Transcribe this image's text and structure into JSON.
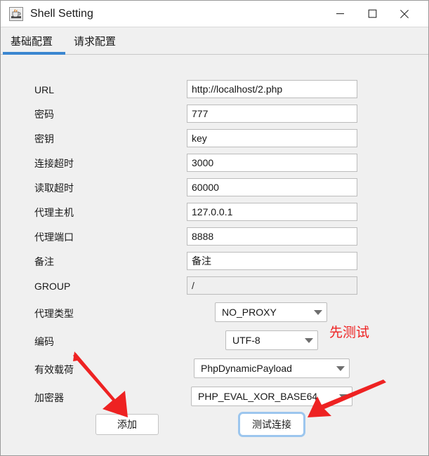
{
  "window": {
    "title": "Shell Setting",
    "icon": "java-coffee-cup-icon",
    "controls": {
      "minimize": "minimize-icon",
      "maximize": "maximize-icon",
      "close": "close-icon"
    }
  },
  "tabs": [
    {
      "label": "基础配置",
      "active": true
    },
    {
      "label": "请求配置",
      "active": false
    }
  ],
  "accent_color": "#3b87d0",
  "annotation_color": "#ee2222",
  "form": {
    "fields": [
      {
        "label": "URL",
        "value": "http://localhost/2.php",
        "type": "text"
      },
      {
        "label": "密码",
        "value": "777",
        "type": "text"
      },
      {
        "label": "密钥",
        "value": "key",
        "type": "text"
      },
      {
        "label": "连接超时",
        "value": "3000",
        "type": "text"
      },
      {
        "label": "读取超时",
        "value": "60000",
        "type": "text"
      },
      {
        "label": "代理主机",
        "value": "127.0.0.1",
        "type": "text"
      },
      {
        "label": "代理端口",
        "value": "8888",
        "type": "text"
      },
      {
        "label": "备注",
        "value": "备注",
        "type": "text"
      },
      {
        "label": "GROUP",
        "value": "/",
        "type": "text-readonly"
      }
    ],
    "selects": [
      {
        "label": "代理类型",
        "value": "NO_PROXY"
      },
      {
        "label": "编码",
        "value": "UTF-8"
      },
      {
        "label": "有效载荷",
        "value": "PhpDynamicPayload"
      },
      {
        "label": "加密器",
        "value": "PHP_EVAL_XOR_BASE64"
      }
    ]
  },
  "buttons": {
    "add": "添加",
    "test_connection": "测试连接"
  },
  "annotations": {
    "note": "先测试",
    "arrow_left": "red-arrow-icon",
    "arrow_right": "red-arrow-icon"
  }
}
